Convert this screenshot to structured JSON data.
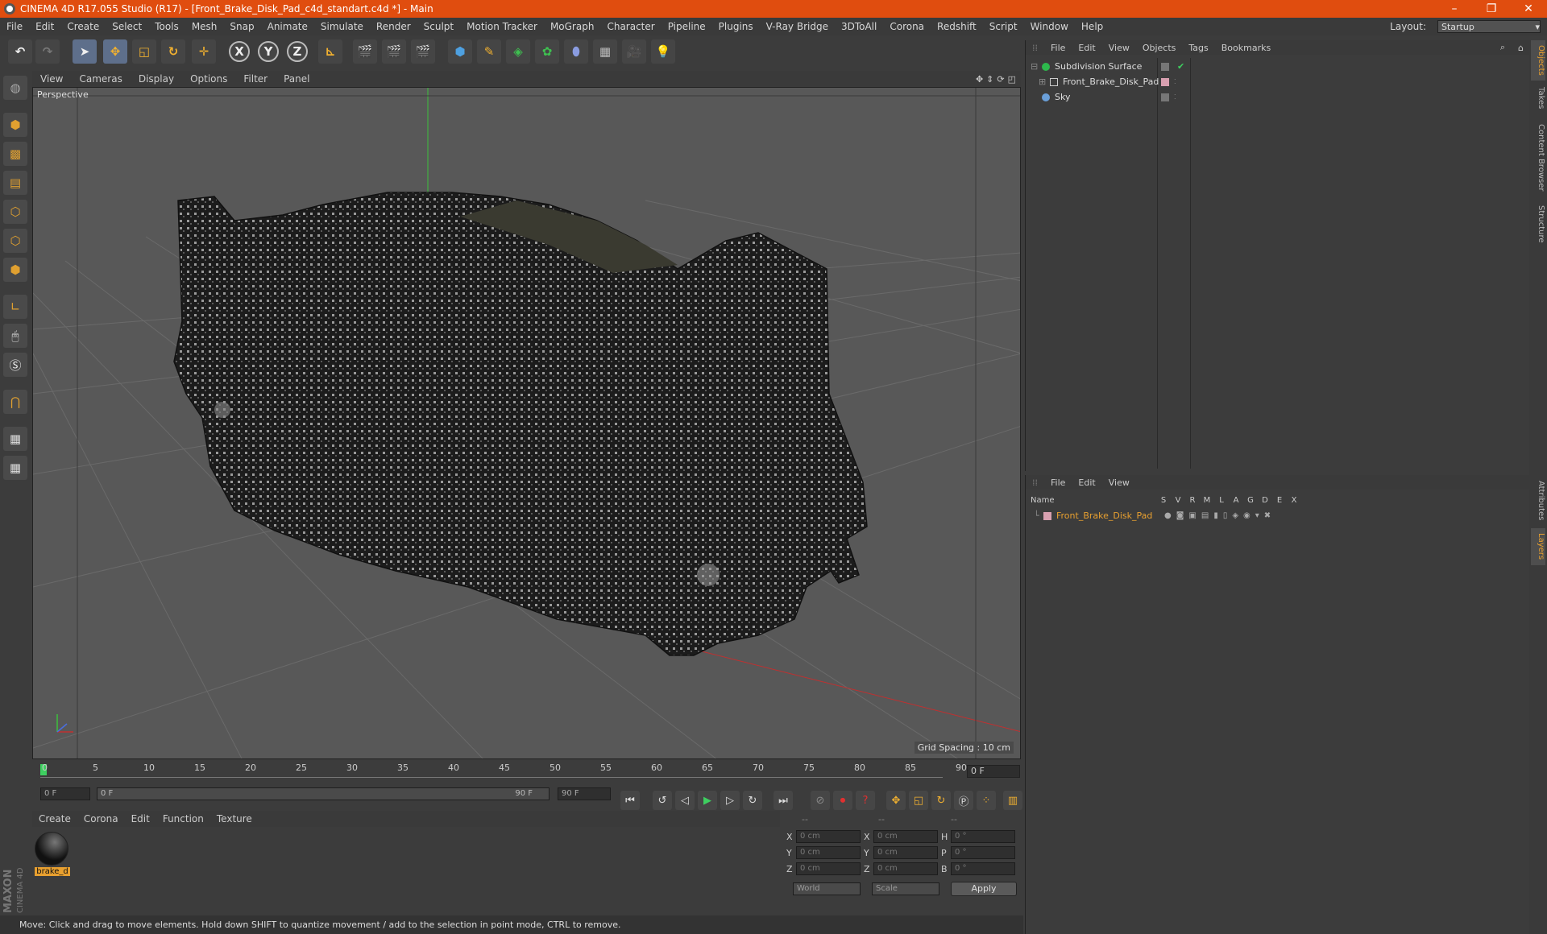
{
  "window": {
    "title": "CINEMA 4D R17.055 Studio (R17) - [Front_Brake_Disk_Pad_c4d_standart.c4d *] - Main",
    "minimize": "–",
    "maximize": "❐",
    "close": "✕"
  },
  "menubar": {
    "items": [
      "File",
      "Edit",
      "Create",
      "Select",
      "Tools",
      "Mesh",
      "Snap",
      "Animate",
      "Simulate",
      "Render",
      "Sculpt",
      "Motion Tracker",
      "MoGraph",
      "Character",
      "Pipeline",
      "Plugins",
      "V-Ray Bridge",
      "3DToAll",
      "Corona",
      "Redshift",
      "Script",
      "Window",
      "Help"
    ],
    "layout_label": "Layout:",
    "layout_value": "Startup"
  },
  "toolbar": {
    "axis_x": "X",
    "axis_y": "Y",
    "axis_z": "Z"
  },
  "viewport": {
    "menu": [
      "View",
      "Cameras",
      "Display",
      "Options",
      "Filter",
      "Panel"
    ],
    "label": "Perspective",
    "grid_spacing": "Grid Spacing : 10 cm"
  },
  "timeline": {
    "ticks": [
      "0",
      "5",
      "10",
      "15",
      "20",
      "25",
      "30",
      "35",
      "40",
      "45",
      "50",
      "55",
      "60",
      "65",
      "70",
      "75",
      "80",
      "85",
      "90"
    ],
    "current_frame": "0 F"
  },
  "transport": {
    "start_field": "0 F",
    "range_start": "0 F",
    "range_end": "90 F",
    "end_field": "90 F"
  },
  "material_panel": {
    "menu": [
      "Create",
      "Corona",
      "Edit",
      "Function",
      "Texture"
    ],
    "material_name": "brake_d"
  },
  "coord_panel": {
    "header": [
      "--",
      "--",
      "--"
    ],
    "rows": [
      {
        "l1": "X",
        "v1": "0 cm",
        "l2": "X",
        "v2": "0 cm",
        "l3": "H",
        "v3": "0 °"
      },
      {
        "l1": "Y",
        "v1": "0 cm",
        "l2": "Y",
        "v2": "0 cm",
        "l3": "P",
        "v3": "0 °"
      },
      {
        "l1": "Z",
        "v1": "0 cm",
        "l2": "Z",
        "v2": "0 cm",
        "l3": "B",
        "v3": "0 °"
      }
    ],
    "world": "World",
    "scale": "Scale",
    "apply": "Apply"
  },
  "object_manager": {
    "menu": [
      "File",
      "Edit",
      "View",
      "Objects",
      "Tags",
      "Bookmarks"
    ],
    "objects": [
      {
        "name": "Subdivision Surface",
        "color": "#2db84c"
      },
      {
        "name": "Front_Brake_Disk_Pad",
        "color": "#cccccc"
      },
      {
        "name": "Sky",
        "color": "#6a9fd8"
      }
    ]
  },
  "layer_manager": {
    "menu": [
      "File",
      "Edit",
      "View"
    ],
    "columns": [
      "Name",
      "S",
      "V",
      "R",
      "M",
      "L",
      "A",
      "G",
      "D",
      "E",
      "X"
    ],
    "layers": [
      {
        "name": "Front_Brake_Disk_Pad",
        "color": "#e8a030"
      }
    ]
  },
  "side_tabs": [
    "Objects",
    "Takes",
    "Content Browser",
    "Structure",
    "Attributes",
    "Layers"
  ],
  "statusbar": {
    "text": "Move: Click and drag to move elements. Hold down SHIFT to quantize movement / add to the selection in point mode, CTRL to remove."
  },
  "brand": {
    "maxon": "MAXON",
    "cinema": "CINEMA 4D"
  }
}
